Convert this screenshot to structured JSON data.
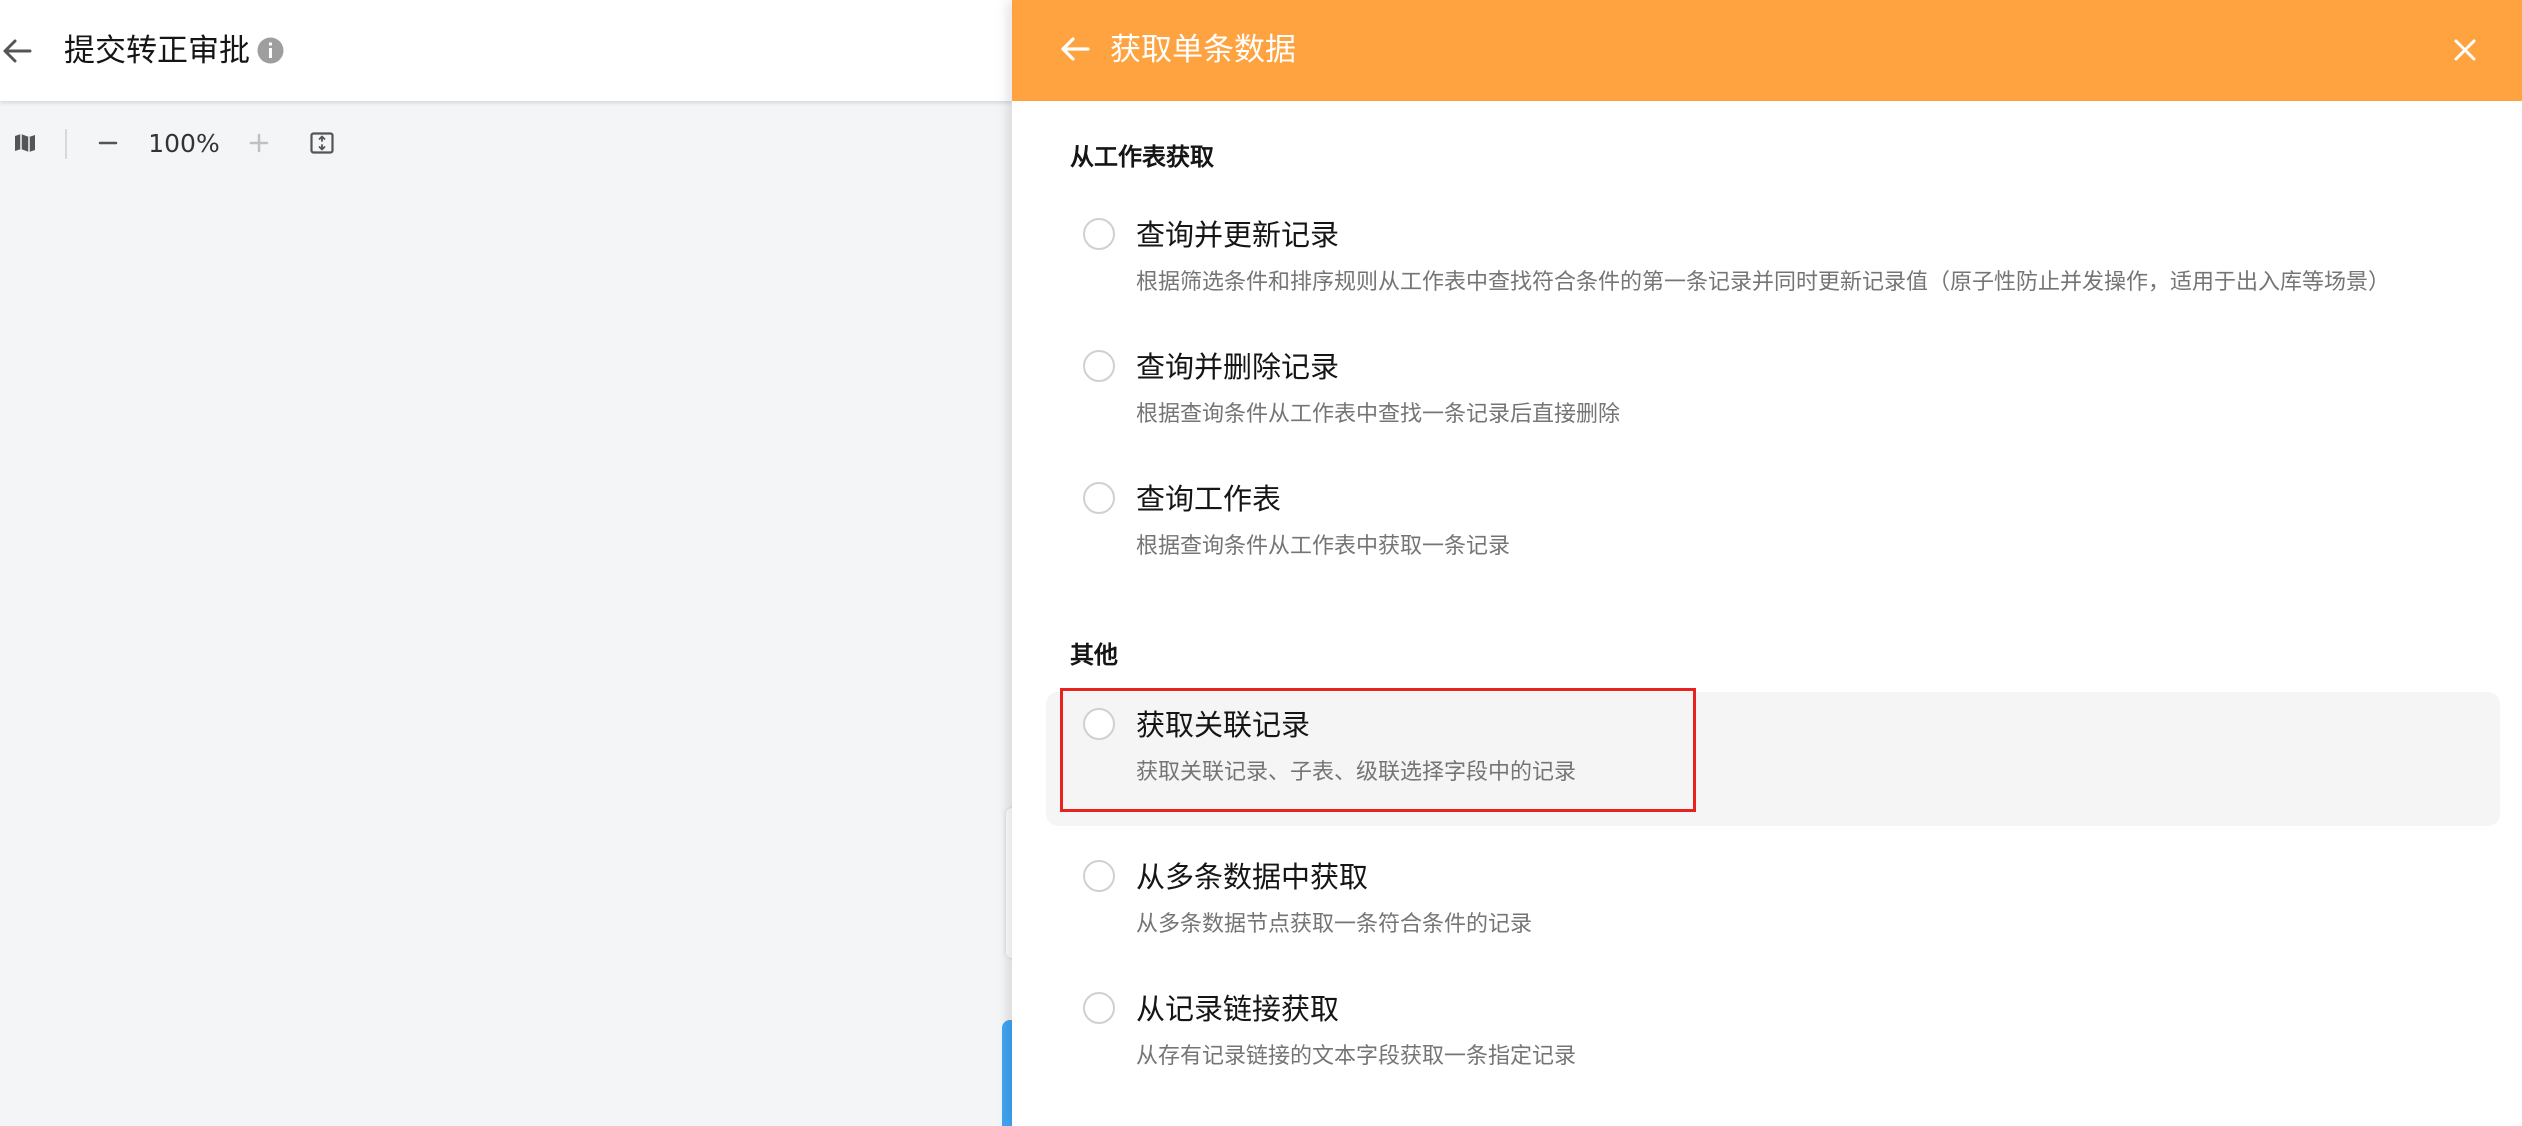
{
  "editor": {
    "title": "提交转正审批",
    "toolbar": {
      "zoom_level": "100%"
    }
  },
  "drawer": {
    "title": "获取单条数据",
    "header_color": "#ffa340",
    "sections": [
      {
        "title": "从工作表获取",
        "options": [
          {
            "label": "查询并更新记录",
            "desc": "根据筛选条件和排序规则从工作表中查找符合条件的第一条记录并同时更新记录值（原子性防止并发操作，适用于出入库等场景）",
            "selected": false
          },
          {
            "label": "查询并删除记录",
            "desc": "根据查询条件从工作表中查找一条记录后直接删除",
            "selected": false
          },
          {
            "label": "查询工作表",
            "desc": "根据查询条件从工作表中获取一条记录",
            "selected": false
          }
        ]
      },
      {
        "title": "其他",
        "options": [
          {
            "label": "获取关联记录",
            "desc": "获取关联记录、子表、级联选择字段中的记录",
            "selected": false,
            "hovered": true
          },
          {
            "label": "从多条数据中获取",
            "desc": "从多条数据节点获取一条符合条件的记录",
            "selected": false
          },
          {
            "label": "从记录链接获取",
            "desc": "从存有记录链接的文本字段获取一条指定记录",
            "selected": false
          }
        ]
      }
    ]
  },
  "annotation": {
    "highlight_color": "#e8231f"
  },
  "icons": [
    "back-arrow-icon",
    "info-icon",
    "map-icon",
    "zoom-out-icon",
    "zoom-in-icon",
    "fit-screen-icon",
    "close-icon"
  ]
}
